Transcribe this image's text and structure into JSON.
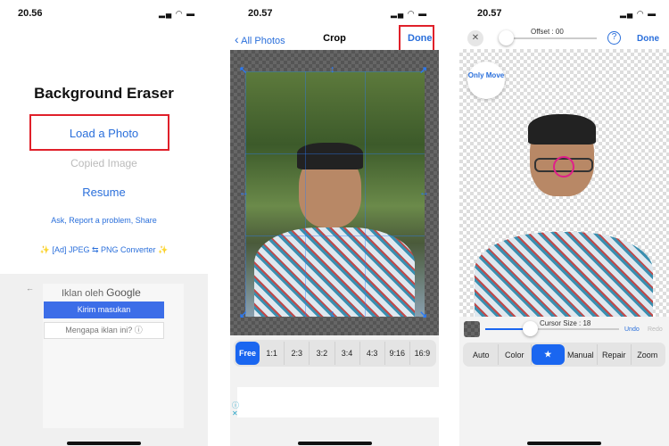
{
  "screen1": {
    "status_time": "20.56",
    "title": "Background Eraser",
    "load_photo": "Load a Photo",
    "copied_image": "Copied Image",
    "resume": "Resume",
    "links": "Ask, Report a problem, Share",
    "ad_converter": "✨ [Ad] JPEG ⇆ PNG Converter ✨",
    "ad": {
      "label_prefix": "Iklan oleh",
      "label_brand": "Google",
      "feedback_button": "Kirim masukan",
      "why_button": "Mengapa iklan ini? ⓘ"
    },
    "highlight_color": "#e0202a"
  },
  "screen2": {
    "status_time": "20.57",
    "back_label": "All Photos",
    "title": "Crop",
    "done": "Done",
    "aspect_options": [
      "Free",
      "1:1",
      "2:3",
      "3:2",
      "3:4",
      "4:3",
      "9:16",
      "16:9"
    ],
    "selected_aspect": "Free",
    "ad_icons": [
      "info-icon",
      "close-icon"
    ]
  },
  "screen3": {
    "status_time": "20.57",
    "offset_label": "Offset : 00",
    "offset_value": 0,
    "help": "?",
    "done": "Done",
    "only_move": "Only Move",
    "cursor_size_label": "Cursor Size : 18",
    "cursor_size": 18,
    "undo": "Undo",
    "redo": "Redo",
    "tools": [
      "Auto",
      "Color",
      "★",
      "Manual",
      "Repair",
      "Zoom"
    ],
    "selected_tool": "★"
  },
  "accent": "#1a66f0"
}
